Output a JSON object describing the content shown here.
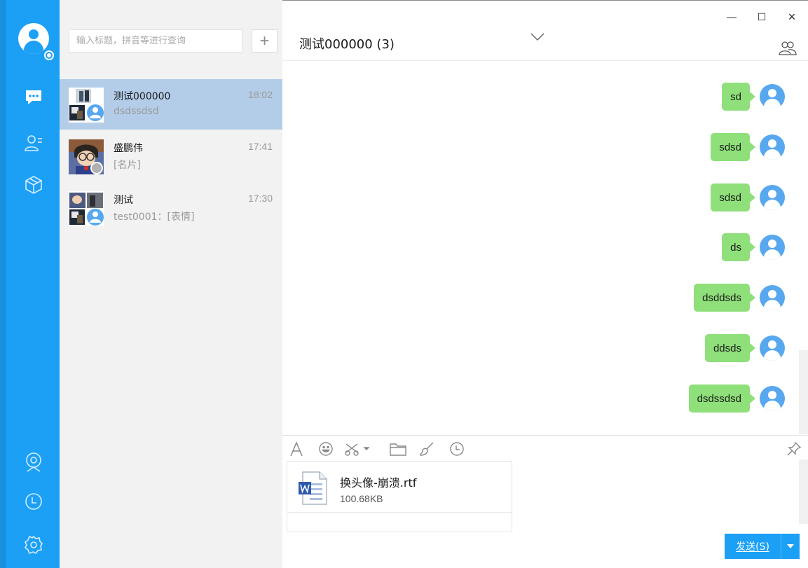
{
  "window": {
    "minimize": "—",
    "maximize": "☐",
    "close": "×"
  },
  "search": {
    "placeholder": "输入标题，拼音等进行查询",
    "add_label": "+"
  },
  "conversations": [
    {
      "name": "测试000000",
      "time": "18:02",
      "preview": "dsdssdsd",
      "active": true
    },
    {
      "name": "盛鹏伟",
      "time": "17:41",
      "preview": "[名片]",
      "active": false
    },
    {
      "name": "测试",
      "time": "17:30",
      "preview": "test0001：[表情]",
      "active": false
    }
  ],
  "chat": {
    "title": "测试000000 (3)",
    "messages": [
      "sd",
      "sdsd",
      "sdsd",
      "ds",
      "dsddsds",
      "ddsds",
      "dsdssdsd"
    ]
  },
  "attachment": {
    "name": "换头像-崩溃.rtf",
    "size": "100.68KB"
  },
  "send": {
    "label": "发送(S)"
  },
  "colors": {
    "sidebar": "#1ca0f5",
    "bubble": "#8fe07a",
    "active_item": "#b3cde9",
    "avatar": "#58a8f0"
  }
}
